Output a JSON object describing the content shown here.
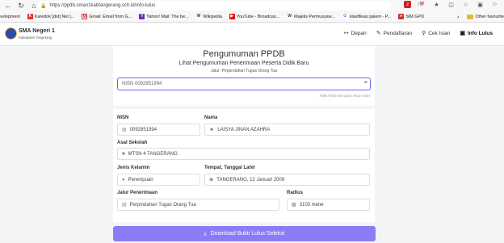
{
  "browser": {
    "url": "https://ppdb.sman1kabtangerang.sch.id/info-lulus",
    "bookmarks": [
      {
        "label": "velopment",
        "color": "#4a4a4a"
      },
      {
        "label": "Karedok [dot] Net |...",
        "color": "#d33"
      },
      {
        "label": "Gmail: Email from G...",
        "color": "#c33"
      },
      {
        "label": "Yahoo! Mail: The be...",
        "color": "#6b2fb3"
      },
      {
        "label": "Wikipedia",
        "color": "#555"
      },
      {
        "label": "YouTube - Broadcas...",
        "color": "#e00"
      },
      {
        "label": "Majelis Permusyaw...",
        "color": "#555"
      },
      {
        "label": "klasifikasi palem - P...",
        "color": "#4285f4"
      },
      {
        "label": "SIM GPO",
        "color": "#c33"
      }
    ],
    "other_favourites": "Other favourite"
  },
  "site": {
    "school_name": "SMA Negeri 1",
    "school_sub": "Kabupaten Tangerang",
    "nav": [
      {
        "label": "Depan",
        "icon": "login-icon"
      },
      {
        "label": "Pendaftaran",
        "icon": "clipboard-icon"
      },
      {
        "label": "Cek Isian",
        "icon": "search-icon"
      },
      {
        "label": "Info Lulus",
        "icon": "info-icon"
      }
    ]
  },
  "main": {
    "title": "Pengumuman PPDB",
    "subtitle": "Lihat Pengumuman Penerimaan Peserta Didik Baru",
    "jalur": "Jalur: Perpindahan Tugas Orang Tua",
    "search_value": "NISN 0092851994",
    "hint": "Ketik NISN kemudian tekan enter"
  },
  "result": {
    "nisn_label": "NISN",
    "nisn_value": "0092851994",
    "nama_label": "Nama",
    "nama_value": "LAISYA JINAN AZAHRA",
    "sekolah_label": "Asal Sekolah",
    "sekolah_value": "MTSN 4 TANGERANG",
    "kelamin_label": "Jenis Kelamin",
    "kelamin_value": "Perempuan",
    "ttl_label": "Tempat, Tanggal Lahir",
    "ttl_value": "TANGERANG, 12 Januari 2009",
    "jalur_label": "Jalur Penerimaan",
    "jalur_value": "Perpindahan Tugas Orang Tua",
    "radius_label": "Radius",
    "radius_value": "3103 meter"
  },
  "download_label": "Download Bukti Lulus Seleksi"
}
